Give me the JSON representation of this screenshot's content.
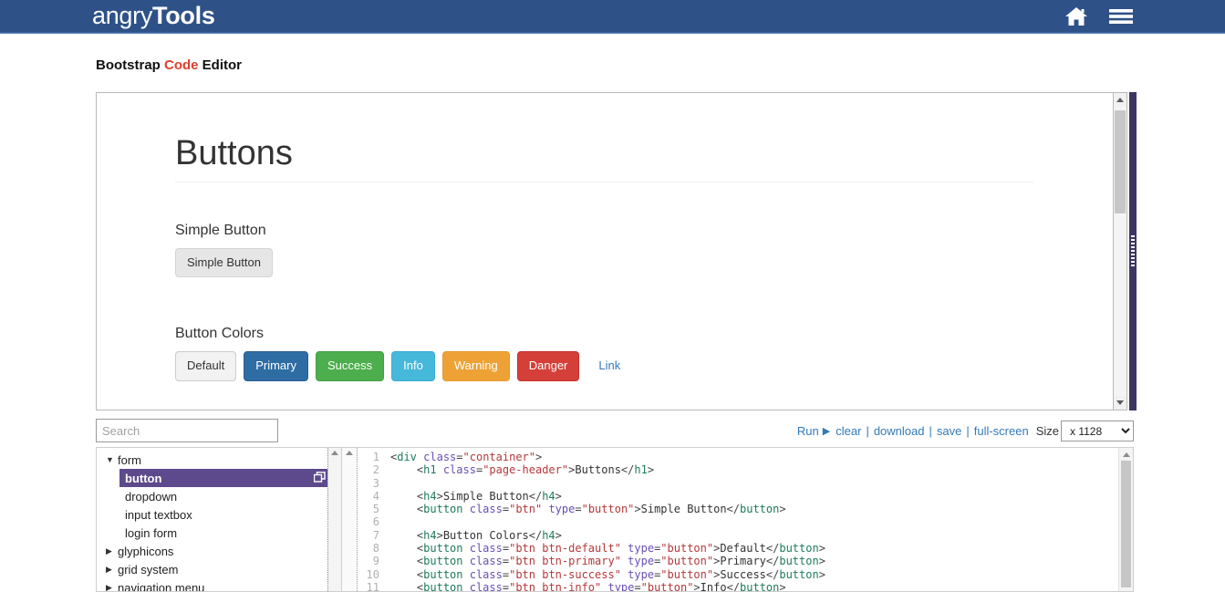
{
  "navbar": {
    "brand_light": "angry",
    "brand_bold": "Tools",
    "home_icon": "home-icon",
    "menu_icon": "hamburger-menu-icon",
    "background": "#2e5288"
  },
  "page": {
    "title_part1": "Bootstrap ",
    "title_accent": "Code",
    "title_part2": " Editor",
    "accent_color": "#e23d2e"
  },
  "preview": {
    "heading": "Buttons",
    "sections": [
      {
        "label": "Simple Button"
      },
      {
        "label": "Button Colors"
      }
    ],
    "simple_button": "Simple Button",
    "color_buttons": [
      {
        "label": "Default",
        "variant": "default",
        "color": "#f2f2f2"
      },
      {
        "label": "Primary",
        "variant": "primary",
        "color": "#2e6da4"
      },
      {
        "label": "Success",
        "variant": "success",
        "color": "#4cae4c"
      },
      {
        "label": "Info",
        "variant": "info",
        "color": "#46b8da"
      },
      {
        "label": "Warning",
        "variant": "warning",
        "color": "#eea236"
      },
      {
        "label": "Danger",
        "variant": "danger",
        "color": "#d43f3a"
      },
      {
        "label": "Link",
        "variant": "link",
        "color": "#337ab7"
      }
    ]
  },
  "toolbar": {
    "search_placeholder": "Search",
    "search_value": "",
    "run_label": "Run",
    "run_icon": "play-triangle-icon",
    "clear_label": "clear",
    "download_label": "download",
    "save_label": "save",
    "fullscreen_label": "full-screen",
    "size_label": "Size",
    "size_value": "x 1128",
    "separator": "|"
  },
  "tree": {
    "nodes": [
      {
        "label": "form",
        "caret": "▼",
        "expanded": true,
        "children": [
          {
            "label": "button",
            "selected": true,
            "icon": "open-in-window-icon"
          },
          {
            "label": "dropdown",
            "selected": false
          },
          {
            "label": "input textbox",
            "selected": false
          },
          {
            "label": "login form",
            "selected": false
          }
        ]
      },
      {
        "label": "glyphicons",
        "caret": "▶",
        "expanded": false,
        "children": []
      },
      {
        "label": "grid system",
        "caret": "▶",
        "expanded": false,
        "children": []
      },
      {
        "label": "navigation menu",
        "caret": "▶",
        "expanded": false,
        "children": []
      }
    ],
    "selected_background": "#5d4a8c"
  },
  "editor": {
    "line_numbers": [
      "1",
      "2",
      "3",
      "4",
      "5",
      "6",
      "7",
      "8",
      "9",
      "10",
      "11"
    ],
    "lines": [
      [
        {
          "t": "punc",
          "v": "<"
        },
        {
          "t": "tag",
          "v": "div"
        },
        {
          "t": "text",
          "v": " "
        },
        {
          "t": "attr",
          "v": "class"
        },
        {
          "t": "punc",
          "v": "="
        },
        {
          "t": "val",
          "v": "\"container\""
        },
        {
          "t": "punc",
          "v": ">"
        }
      ],
      [
        {
          "t": "text",
          "v": "    "
        },
        {
          "t": "punc",
          "v": "<"
        },
        {
          "t": "tag",
          "v": "h1"
        },
        {
          "t": "text",
          "v": " "
        },
        {
          "t": "attr",
          "v": "class"
        },
        {
          "t": "punc",
          "v": "="
        },
        {
          "t": "val",
          "v": "\"page-header\""
        },
        {
          "t": "punc",
          "v": ">"
        },
        {
          "t": "text",
          "v": "Buttons"
        },
        {
          "t": "punc",
          "v": "</"
        },
        {
          "t": "tag",
          "v": "h1"
        },
        {
          "t": "punc",
          "v": ">"
        }
      ],
      [
        {
          "t": "text",
          "v": ""
        }
      ],
      [
        {
          "t": "text",
          "v": "    "
        },
        {
          "t": "punc",
          "v": "<"
        },
        {
          "t": "tag",
          "v": "h4"
        },
        {
          "t": "punc",
          "v": ">"
        },
        {
          "t": "text",
          "v": "Simple Button"
        },
        {
          "t": "punc",
          "v": "</"
        },
        {
          "t": "tag",
          "v": "h4"
        },
        {
          "t": "punc",
          "v": ">"
        }
      ],
      [
        {
          "t": "text",
          "v": "    "
        },
        {
          "t": "punc",
          "v": "<"
        },
        {
          "t": "tag",
          "v": "button"
        },
        {
          "t": "text",
          "v": " "
        },
        {
          "t": "attr",
          "v": "class"
        },
        {
          "t": "punc",
          "v": "="
        },
        {
          "t": "val",
          "v": "\"btn\""
        },
        {
          "t": "text",
          "v": " "
        },
        {
          "t": "attr",
          "v": "type"
        },
        {
          "t": "punc",
          "v": "="
        },
        {
          "t": "val",
          "v": "\"button\""
        },
        {
          "t": "punc",
          "v": ">"
        },
        {
          "t": "text",
          "v": "Simple Button"
        },
        {
          "t": "punc",
          "v": "</"
        },
        {
          "t": "tag",
          "v": "button"
        },
        {
          "t": "punc",
          "v": ">"
        }
      ],
      [
        {
          "t": "text",
          "v": ""
        }
      ],
      [
        {
          "t": "text",
          "v": "    "
        },
        {
          "t": "punc",
          "v": "<"
        },
        {
          "t": "tag",
          "v": "h4"
        },
        {
          "t": "punc",
          "v": ">"
        },
        {
          "t": "text",
          "v": "Button Colors"
        },
        {
          "t": "punc",
          "v": "</"
        },
        {
          "t": "tag",
          "v": "h4"
        },
        {
          "t": "punc",
          "v": ">"
        }
      ],
      [
        {
          "t": "text",
          "v": "    "
        },
        {
          "t": "punc",
          "v": "<"
        },
        {
          "t": "tag",
          "v": "button"
        },
        {
          "t": "text",
          "v": " "
        },
        {
          "t": "attr",
          "v": "class"
        },
        {
          "t": "punc",
          "v": "="
        },
        {
          "t": "val",
          "v": "\"btn btn-default\""
        },
        {
          "t": "text",
          "v": " "
        },
        {
          "t": "attr",
          "v": "type"
        },
        {
          "t": "punc",
          "v": "="
        },
        {
          "t": "val",
          "v": "\"button\""
        },
        {
          "t": "punc",
          "v": ">"
        },
        {
          "t": "text",
          "v": "Default"
        },
        {
          "t": "punc",
          "v": "</"
        },
        {
          "t": "tag",
          "v": "button"
        },
        {
          "t": "punc",
          "v": ">"
        }
      ],
      [
        {
          "t": "text",
          "v": "    "
        },
        {
          "t": "punc",
          "v": "<"
        },
        {
          "t": "tag",
          "v": "button"
        },
        {
          "t": "text",
          "v": " "
        },
        {
          "t": "attr",
          "v": "class"
        },
        {
          "t": "punc",
          "v": "="
        },
        {
          "t": "val",
          "v": "\"btn btn-primary\""
        },
        {
          "t": "text",
          "v": " "
        },
        {
          "t": "attr",
          "v": "type"
        },
        {
          "t": "punc",
          "v": "="
        },
        {
          "t": "val",
          "v": "\"button\""
        },
        {
          "t": "punc",
          "v": ">"
        },
        {
          "t": "text",
          "v": "Primary"
        },
        {
          "t": "punc",
          "v": "</"
        },
        {
          "t": "tag",
          "v": "button"
        },
        {
          "t": "punc",
          "v": ">"
        }
      ],
      [
        {
          "t": "text",
          "v": "    "
        },
        {
          "t": "punc",
          "v": "<"
        },
        {
          "t": "tag",
          "v": "button"
        },
        {
          "t": "text",
          "v": " "
        },
        {
          "t": "attr",
          "v": "class"
        },
        {
          "t": "punc",
          "v": "="
        },
        {
          "t": "val",
          "v": "\"btn btn-success\""
        },
        {
          "t": "text",
          "v": " "
        },
        {
          "t": "attr",
          "v": "type"
        },
        {
          "t": "punc",
          "v": "="
        },
        {
          "t": "val",
          "v": "\"button\""
        },
        {
          "t": "punc",
          "v": ">"
        },
        {
          "t": "text",
          "v": "Success"
        },
        {
          "t": "punc",
          "v": "</"
        },
        {
          "t": "tag",
          "v": "button"
        },
        {
          "t": "punc",
          "v": ">"
        }
      ],
      [
        {
          "t": "text",
          "v": "    "
        },
        {
          "t": "punc",
          "v": "<"
        },
        {
          "t": "tag",
          "v": "button"
        },
        {
          "t": "text",
          "v": " "
        },
        {
          "t": "attr",
          "v": "class"
        },
        {
          "t": "punc",
          "v": "="
        },
        {
          "t": "val",
          "v": "\"btn btn-info\""
        },
        {
          "t": "text",
          "v": " "
        },
        {
          "t": "attr",
          "v": "type"
        },
        {
          "t": "punc",
          "v": "="
        },
        {
          "t": "val",
          "v": "\"button\""
        },
        {
          "t": "punc",
          "v": ">"
        },
        {
          "t": "text",
          "v": "Info"
        },
        {
          "t": "punc",
          "v": "</"
        },
        {
          "t": "tag",
          "v": "button"
        },
        {
          "t": "punc",
          "v": ">"
        }
      ]
    ]
  }
}
